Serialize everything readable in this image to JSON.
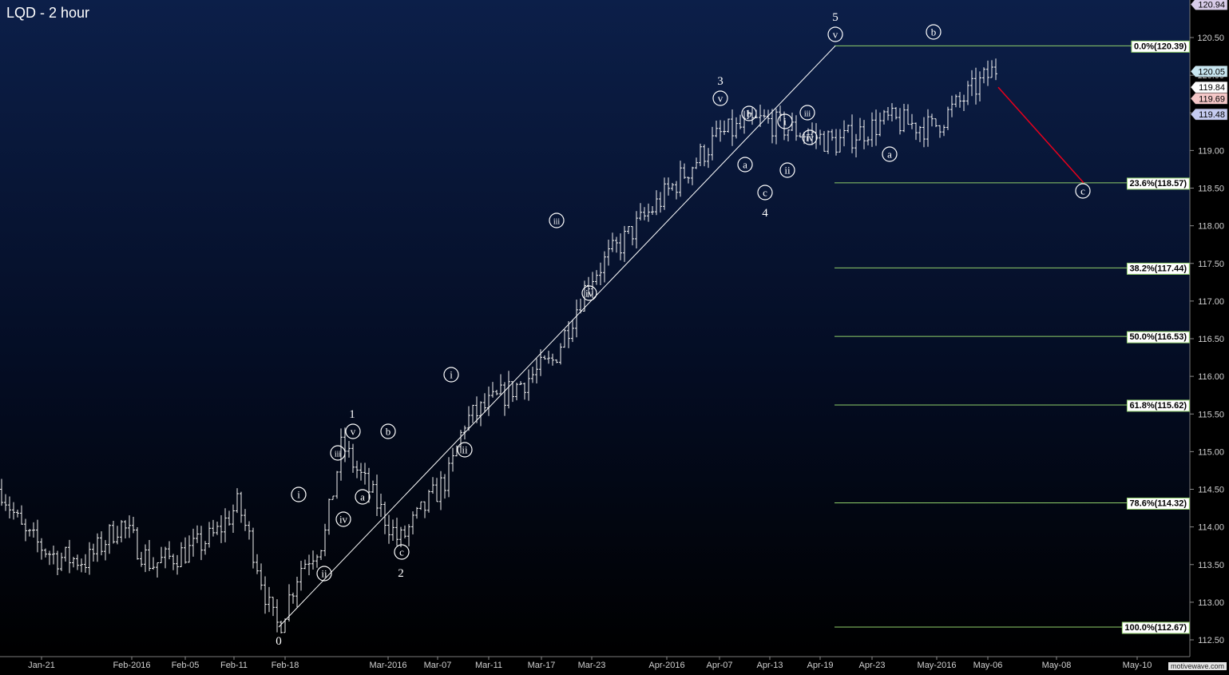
{
  "title": "LQD - 2 hour",
  "watermark": "motivewave.com",
  "chart_data": {
    "type": "ohlc",
    "title": "LQD - 2 hour",
    "ylim": [
      112.3,
      121.0
    ],
    "y_ticks": [
      112.5,
      113.0,
      113.5,
      114.0,
      114.5,
      115.0,
      115.5,
      116.0,
      116.5,
      117.0,
      117.5,
      118.0,
      118.5,
      119.0,
      119.5,
      120.0,
      120.5
    ],
    "x_ticks": [
      "Jan-21",
      "Feb-2016",
      "Feb-05",
      "Feb-11",
      "Feb-18",
      "Mar-2016",
      "Mar-07",
      "Mar-11",
      "Mar-17",
      "Mar-23",
      "Apr-2016",
      "Apr-07",
      "Apr-13",
      "Apr-19",
      "Apr-23",
      "May-2016",
      "May-06",
      "May-08",
      "May-10"
    ],
    "price_tags": [
      {
        "value": 120.94,
        "color": "#d8cce8"
      },
      {
        "value": 120.05,
        "color": "#c8e6f0"
      },
      {
        "value": 119.84,
        "color": "#ffffff"
      },
      {
        "value": 119.69,
        "color": "#f4c7c7"
      },
      {
        "value": 119.48,
        "color": "#c5cbf0"
      }
    ],
    "fibonacci": {
      "levels": [
        {
          "label": "0.0%(120.39)",
          "value": 120.39
        },
        {
          "label": "23.6%(118.57)",
          "value": 118.57
        },
        {
          "label": "38.2%(117.44)",
          "value": 117.44
        },
        {
          "label": "50.0%(116.53)",
          "value": 116.53
        },
        {
          "label": "61.8%(115.62)",
          "value": 115.62
        },
        {
          "label": "78.6%(114.32)",
          "value": 114.32
        },
        {
          "label": "100.0%(112.67)",
          "value": 112.67
        }
      ]
    },
    "wave_labels": [
      {
        "text": "0",
        "circled": false
      },
      {
        "text": "i",
        "circled": true
      },
      {
        "text": "ii",
        "circled": true
      },
      {
        "text": "iii",
        "circled": true
      },
      {
        "text": "iv",
        "circled": true
      },
      {
        "text": "v",
        "circled": true
      },
      {
        "text": "1",
        "circled": false
      },
      {
        "text": "a",
        "circled": true
      },
      {
        "text": "b",
        "circled": true
      },
      {
        "text": "c",
        "circled": true
      },
      {
        "text": "2",
        "circled": false
      },
      {
        "text": "i",
        "circled": true
      },
      {
        "text": "ii",
        "circled": true
      },
      {
        "text": "iii",
        "circled": true
      },
      {
        "text": "iv",
        "circled": true
      },
      {
        "text": "v",
        "circled": true
      },
      {
        "text": "3",
        "circled": false
      },
      {
        "text": "a",
        "circled": true
      },
      {
        "text": "b",
        "circled": true
      },
      {
        "text": "c",
        "circled": true
      },
      {
        "text": "4",
        "circled": false
      },
      {
        "text": "i",
        "circled": true
      },
      {
        "text": "ii",
        "circled": true
      },
      {
        "text": "iii",
        "circled": true
      },
      {
        "text": "iv",
        "circled": true
      },
      {
        "text": "v",
        "circled": true
      },
      {
        "text": "5",
        "circled": false
      },
      {
        "text": "a",
        "circled": true
      },
      {
        "text": "b",
        "circled": true
      },
      {
        "text": "c",
        "circled": true
      }
    ],
    "anchors": [
      [
        112.67,
        112.67,
        112.7,
        112.75
      ],
      [
        113.45,
        113.75,
        113.9,
        114.0
      ],
      [
        113.85,
        113.7,
        114.4,
        114.75
      ],
      [
        115.1,
        114.5,
        114.6,
        115.1
      ],
      [
        113.8,
        114.1,
        114.2,
        114.5
      ],
      [
        114.7,
        115.0,
        115.5,
        115.9
      ],
      [
        115.4,
        115.5,
        116.4,
        116.7
      ],
      [
        116.2,
        117.0,
        117.6,
        117.9
      ],
      [
        117.3,
        117.5,
        118.4,
        118.9
      ],
      [
        119.2,
        119.0,
        119.2,
        119.6
      ],
      [
        119.4,
        118.7,
        118.8,
        119.2
      ],
      [
        119.1,
        119.6,
        120.0,
        120.39
      ],
      [
        119.4,
        119.8,
        119.5,
        119.1
      ],
      [
        119.3,
        120.0,
        120.3,
        119.9
      ],
      [
        120.1,
        119.8,
        119.9,
        119.84
      ]
    ],
    "wave_lines": [
      {
        "from": 112.67,
        "to": 120.39,
        "color": "#ffffff"
      },
      {
        "from": 119.84,
        "to": 118.57,
        "color": "#e8001c"
      }
    ],
    "grid": false
  }
}
